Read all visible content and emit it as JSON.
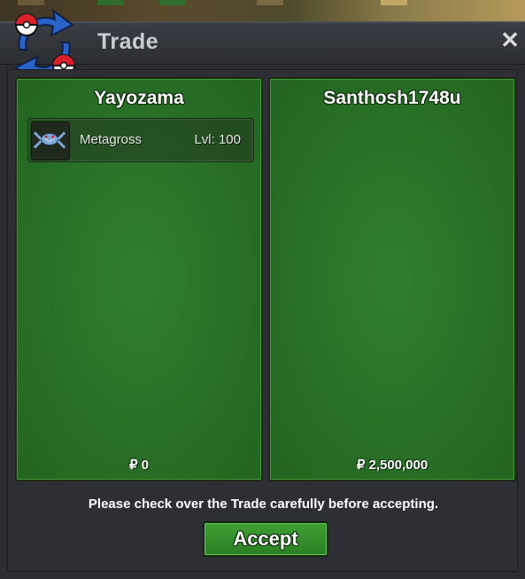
{
  "window": {
    "title": "Trade",
    "close_glyph": "✕"
  },
  "left_panel": {
    "player": "Yayozama",
    "offer": {
      "pokemon": "Metagross",
      "level": "Lvl: 100",
      "icon": "metagross-sprite"
    },
    "money": "₽ 0"
  },
  "right_panel": {
    "player": "Santhosh1748u",
    "money": "₽ 2,500,000"
  },
  "notice": "Please check over the Trade carefully before accepting.",
  "accept_label": "Accept",
  "colors": {
    "panel_green": "#2b742a",
    "accent_red": "#d8202a",
    "accent_blue": "#2a63c7"
  }
}
